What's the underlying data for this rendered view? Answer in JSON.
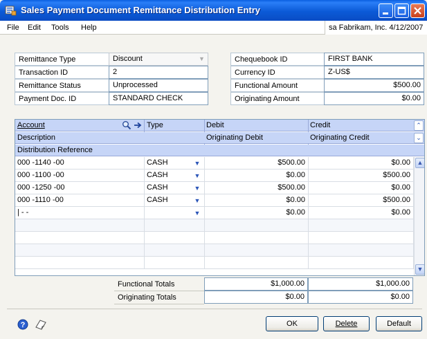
{
  "window": {
    "title": "Sales Payment Document Remittance Distribution Entry"
  },
  "menu": {
    "file": "File",
    "edit": "Edit",
    "tools": "Tools",
    "help": "Help"
  },
  "user_info": "sa  Fabrikam, Inc.  4/12/2007",
  "header": {
    "remittance_type_label": "Remittance Type",
    "remittance_type_value": "Discount",
    "transaction_id_label": "Transaction ID",
    "transaction_id_value": "2",
    "remittance_status_label": "Remittance Status",
    "remittance_status_value": "Unprocessed",
    "payment_doc_id_label": "Payment Doc. ID",
    "payment_doc_id_value": "STANDARD CHECK",
    "chequebook_id_label": "Chequebook ID",
    "chequebook_id_value": "FIRST BANK",
    "currency_id_label": "Currency ID",
    "currency_id_value": "Z-US$",
    "functional_amount_label": "Functional Amount",
    "functional_amount_value": "$500.00",
    "originating_amount_label": "Originating Amount",
    "originating_amount_value": "$0.00"
  },
  "grid": {
    "col_account": "Account",
    "col_type": "Type",
    "col_debit": "Debit",
    "col_credit": "Credit",
    "col_description": "Description",
    "col_orig_debit": "Originating Debit",
    "col_orig_credit": "Originating Credit",
    "col_dist_ref": "Distribution Reference",
    "rows": [
      {
        "account": "000 -1140 -00",
        "type": "CASH",
        "debit": "$500.00",
        "credit": "$0.00"
      },
      {
        "account": "000 -1100 -00",
        "type": "CASH",
        "debit": "$0.00",
        "credit": "$500.00"
      },
      {
        "account": "000 -1250 -00",
        "type": "CASH",
        "debit": "$500.00",
        "credit": "$0.00"
      },
      {
        "account": "000 -1110 -00",
        "type": "CASH",
        "debit": "$0.00",
        "credit": "$500.00"
      },
      {
        "account": "|     -       -",
        "type": "",
        "debit": "$0.00",
        "credit": "$0.00"
      }
    ]
  },
  "totals": {
    "functional_label": "Functional Totals",
    "functional_debit": "$1,000.00",
    "functional_credit": "$1,000.00",
    "originating_label": "Originating Totals",
    "originating_debit": "$0.00",
    "originating_credit": "$0.00"
  },
  "buttons": {
    "ok": "OK",
    "delete": "Delete",
    "default": "Default"
  },
  "icons": {
    "help": "help-icon",
    "note": "note-icon",
    "lookup": "lookup-icon",
    "expand": "expand-icon"
  }
}
